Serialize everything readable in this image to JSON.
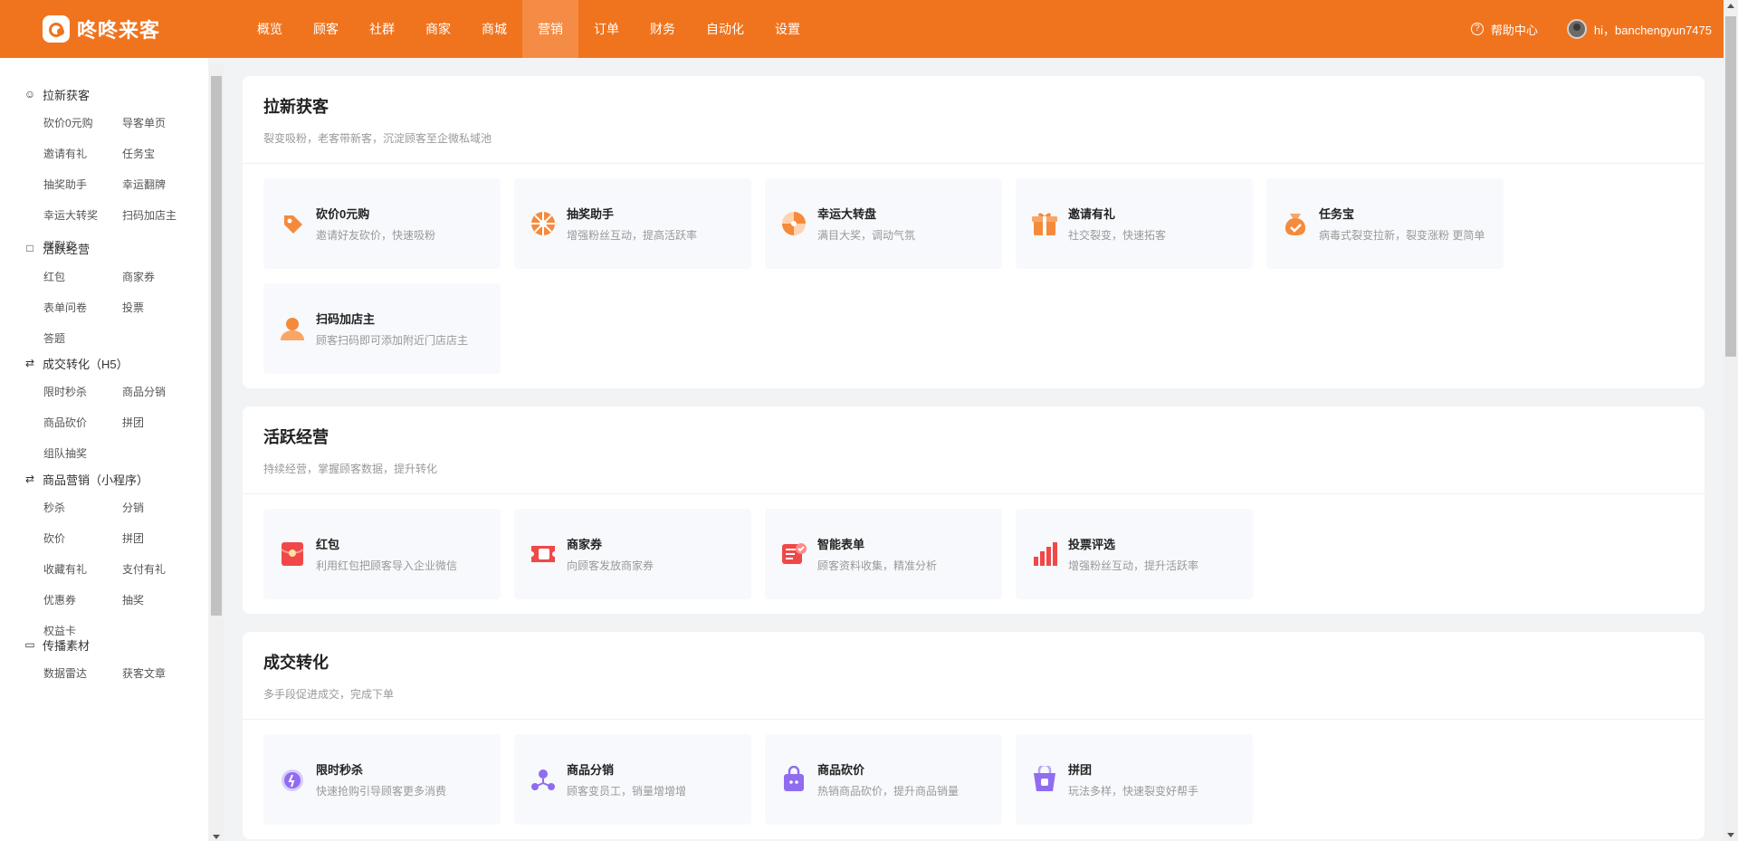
{
  "app": {
    "brand": "咚咚来客",
    "nav": [
      "概览",
      "顾客",
      "社群",
      "商家",
      "商城",
      "营销",
      "订单",
      "财务",
      "自动化",
      "设置"
    ],
    "active_nav": "营销",
    "help": "帮助中心",
    "user_greeting": "hi，banchengyun7475"
  },
  "sidebar": [
    {
      "title": "拉新获客",
      "icon": "user-icon",
      "items": [
        "砍价0元购",
        "导客单页",
        "邀请有礼",
        "任务宝",
        "抽奖助手",
        "幸运翻牌",
        "幸运大转奖",
        "扫码加店主",
        "群裂变"
      ]
    },
    {
      "title": "活跃经营",
      "icon": "lock-icon",
      "items": [
        "红包",
        "商家券",
        "表单问卷",
        "投票",
        "答题"
      ]
    },
    {
      "title": "成交转化（H5）",
      "icon": "swap-icon",
      "items": [
        "限时秒杀",
        "商品分销",
        "商品砍价",
        "拼团",
        "组队抽奖"
      ]
    },
    {
      "title": "商品营销（小程序）",
      "icon": "swap-icon",
      "items": [
        "秒杀",
        "分销",
        "砍价",
        "拼团",
        "收藏有礼",
        "支付有礼",
        "优惠券",
        "抽奖",
        "权益卡"
      ]
    },
    {
      "title": "传播素材",
      "icon": "folder-icon",
      "items": [
        "数据雷达",
        "获客文章"
      ]
    }
  ],
  "sections": [
    {
      "title": "拉新获客",
      "subtitle": "裂变吸粉，老客带新客，沉淀顾客至企微私域池",
      "cards": [
        {
          "title": "砍价0元购",
          "desc": "邀请好友砍价，快速吸粉",
          "icon": "tag-icon",
          "color": "#f58a3c"
        },
        {
          "title": "抽奖助手",
          "desc": "增强粉丝互动，提高活跃率",
          "icon": "wheel-icon",
          "color": "#f58a3c"
        },
        {
          "title": "幸运大转盘",
          "desc": "满目大奖，调动气氛",
          "icon": "spinner-icon",
          "color": "#f58a3c"
        },
        {
          "title": "邀请有礼",
          "desc": "社交裂变，快速拓客",
          "icon": "gift-icon",
          "color": "#f58a3c"
        },
        {
          "title": "任务宝",
          "desc": "病毒式裂变拉新，裂变涨粉 更简单",
          "icon": "bag-icon",
          "color": "#f58a3c"
        },
        {
          "title": "扫码加店主",
          "desc": "顾客扫码即可添加附近门店店主",
          "icon": "person-icon",
          "color": "#f58a3c"
        }
      ]
    },
    {
      "title": "活跃经营",
      "subtitle": "持续经营，掌握顾客数据，提升转化",
      "cards": [
        {
          "title": "红包",
          "desc": "利用红包把顾客导入企业微信",
          "icon": "redpacket-icon",
          "color": "#f04848"
        },
        {
          "title": "商家券",
          "desc": "向顾客发放商家券",
          "icon": "coupon-icon",
          "color": "#f04848"
        },
        {
          "title": "智能表单",
          "desc": "顾客资料收集，精准分析",
          "icon": "form-icon",
          "color": "#f04848"
        },
        {
          "title": "投票评选",
          "desc": "增强粉丝互动，提升活跃率",
          "icon": "bars-icon",
          "color": "#f04848"
        }
      ]
    },
    {
      "title": "成交转化",
      "subtitle": "多手段促进成交，完成下单",
      "cards": [
        {
          "title": "限时秒杀",
          "desc": "快速抢购引导顾客更多消费",
          "icon": "alarm-icon",
          "color": "#8f6cf0"
        },
        {
          "title": "商品分销",
          "desc": "顾客变员工，销量增增增",
          "icon": "network-icon",
          "color": "#8f6cf0"
        },
        {
          "title": "商品砍价",
          "desc": "热销商品砍价，提升商品销量",
          "icon": "shopbag-icon",
          "color": "#8f6cf0"
        },
        {
          "title": "拼团",
          "desc": "玩法多样，快速裂变好帮手",
          "icon": "basket-icon",
          "color": "#8f6cf0"
        }
      ]
    }
  ]
}
